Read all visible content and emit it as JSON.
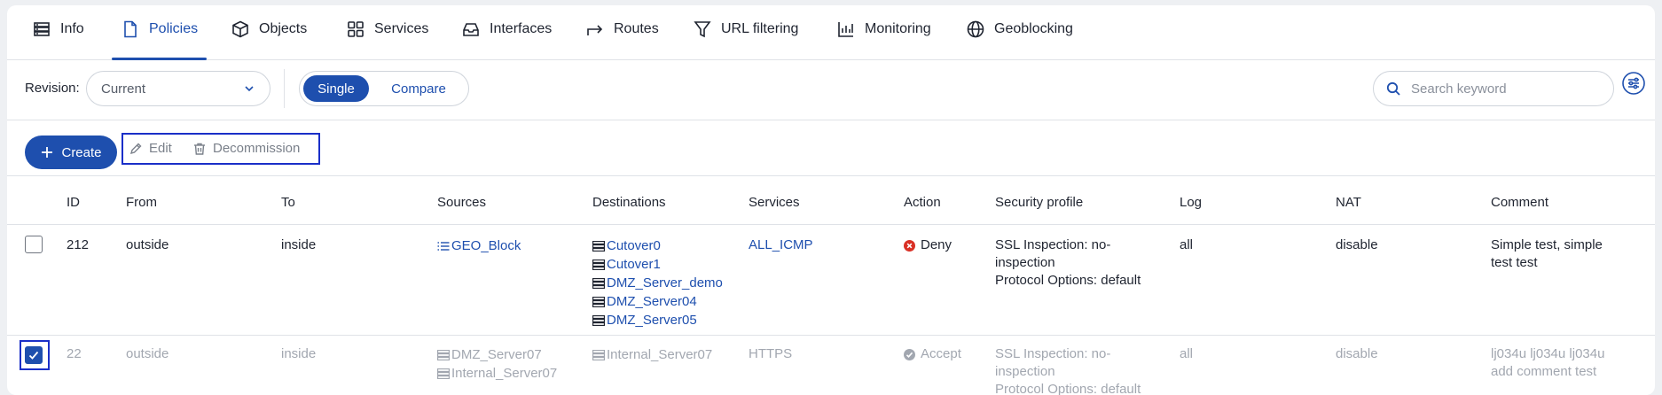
{
  "tabs": [
    {
      "label": "Info",
      "icon": "server-icon"
    },
    {
      "label": "Policies",
      "icon": "document-icon",
      "active": true
    },
    {
      "label": "Objects",
      "icon": "cube-icon"
    },
    {
      "label": "Services",
      "icon": "grid-icon"
    },
    {
      "label": "Interfaces",
      "icon": "inbox-icon"
    },
    {
      "label": "Routes",
      "icon": "arrow-right-icon"
    },
    {
      "label": "URL filtering",
      "icon": "filter-icon"
    },
    {
      "label": "Monitoring",
      "icon": "bar-chart-icon"
    },
    {
      "label": "Geoblocking",
      "icon": "globe-icon"
    }
  ],
  "toolbar": {
    "revision_label": "Revision:",
    "revision_value": "Current",
    "mode_single": "Single",
    "mode_compare": "Compare",
    "search_placeholder": "Search keyword"
  },
  "actions": {
    "create": "Create",
    "edit": "Edit",
    "decommission": "Decommission"
  },
  "table": {
    "columns": [
      "ID",
      "From",
      "To",
      "Sources",
      "Destinations",
      "Services",
      "Action",
      "Security profile",
      "Log",
      "NAT",
      "Comment"
    ],
    "rows": [
      {
        "checked": false,
        "id": "212",
        "from": "outside",
        "to": "inside",
        "sources": [
          "GEO_Block"
        ],
        "destinations": [
          "Cutover0",
          "Cutover1",
          "DMZ_Server_demo",
          "DMZ_Server04",
          "DMZ_Server05"
        ],
        "services": "ALL_ICMP",
        "action": "Deny",
        "security_profile_1": "SSL Inspection: no-",
        "security_profile_2": "inspection",
        "security_profile_3": "Protocol Options: default",
        "log": "all",
        "nat": "disable",
        "comment_1": "Simple test, simple",
        "comment_2": "test test"
      },
      {
        "checked": true,
        "id": "22",
        "from": "outside",
        "to": "inside",
        "sources": [
          "DMZ_Server07",
          "Internal_Server07"
        ],
        "destinations": [
          "Internal_Server07"
        ],
        "services": "HTTPS",
        "action": "Accept",
        "security_profile_1": "SSL Inspection: no-",
        "security_profile_2": "inspection",
        "security_profile_3": "Protocol Options: default",
        "log": "all",
        "nat": "disable",
        "comment_1": "lj034u lj034u lj034u",
        "comment_2": "add comment test"
      }
    ]
  },
  "colors": {
    "accent": "#1e4fae",
    "deny": "#d93025",
    "muted": "#a2a7b0",
    "highlight": "#1a2fc8"
  }
}
